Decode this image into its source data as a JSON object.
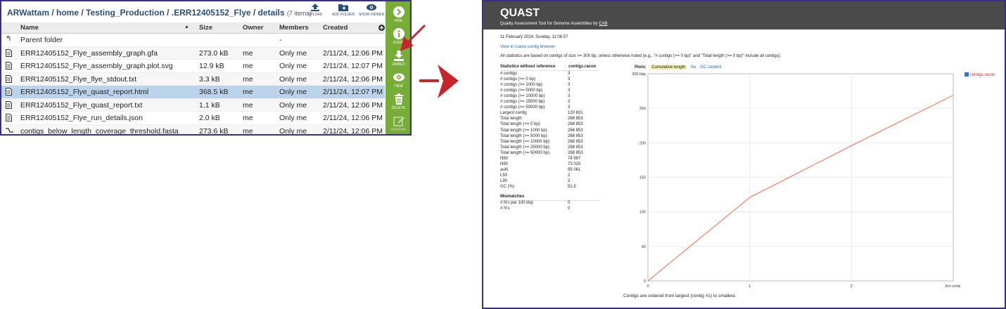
{
  "file_browser": {
    "breadcrumb": "ARWattam / home / Testing_Production / .ERR12405152_Flye / details",
    "item_count": "(7 items)",
    "toolbar": {
      "upload": "UPLOAD",
      "add_folder": "ADD FOLDER",
      "show_hidden": "SHOW HIDDEN"
    },
    "columns": {
      "name": "Name",
      "size": "Size",
      "owner": "Owner",
      "members": "Members",
      "created": "Created"
    },
    "parent": {
      "name": "Parent folder",
      "members": "-"
    },
    "rows": [
      {
        "name": "ERR12405152_Flye_assembly_graph.gfa",
        "size": "273.0 kB",
        "owner": "me",
        "members": "Only me",
        "created": "2/11/24, 12:06 PM"
      },
      {
        "name": "ERR12405152_Flye_assembly_graph.plot.svg",
        "size": "12.9 kB",
        "owner": "me",
        "members": "Only me",
        "created": "2/11/24, 12:07 PM"
      },
      {
        "name": "ERR12405152_Flye_flye_stdout.txt",
        "size": "3.3 kB",
        "owner": "me",
        "members": "Only me",
        "created": "2/11/24, 12:06 PM"
      },
      {
        "name": "ERR12405152_Flye_quast_report.html",
        "size": "368.5 kB",
        "owner": "me",
        "members": "Only me",
        "created": "2/11/24, 12:07 PM"
      },
      {
        "name": "ERR12405152_Flye_quast_report.txt",
        "size": "1.1 kB",
        "owner": "me",
        "members": "Only me",
        "created": "2/11/24, 12:06 PM"
      },
      {
        "name": "ERR12405152_Flye_run_details.json",
        "size": "2.0 kB",
        "owner": "me",
        "members": "Only me",
        "created": "2/11/24, 12:06 PM"
      },
      {
        "name": "contigs_below_length_coverage_threshold.fasta",
        "size": "273.6 kB",
        "owner": "me",
        "members": "Only me",
        "created": "2/11/24, 12:06 PM"
      }
    ],
    "sidebar": {
      "hide": "HIDE",
      "guide": "GUIDE",
      "download": "DWNLD",
      "view": "VIEW",
      "delete": "DELETE",
      "rename": "RENAME"
    }
  },
  "quast": {
    "title": "QUAST",
    "subtitle": "Quality Assessment Tool for Genome Assemblies",
    "by": "by",
    "cab": "CAB",
    "date": "11 February 2024, Sunday, 11:06:57",
    "icarus_link": "View in Icarus contig browser",
    "note": "All statistics are based on contigs of size >= 300 bp, unless otherwise noted (e.g., \"# contigs (>= 0 bp)\" and \"Total length (>= 0 bp)\" include all contigs).",
    "stats_header": "Statistics without reference",
    "assembly": "contigs.racon",
    "stats": [
      [
        "# contigs",
        "3"
      ],
      [
        "# contigs (>= 0 bp)",
        "3"
      ],
      [
        "# contigs (>= 1000 bp)",
        "3"
      ],
      [
        "# contigs (>= 5000 bp)",
        "3"
      ],
      [
        "# contigs (>= 10000 bp)",
        "3"
      ],
      [
        "# contigs (>= 25000 bp)",
        "3"
      ],
      [
        "# contigs (>= 50000 bp)",
        "3"
      ],
      [
        "Largest contig",
        "120 831"
      ],
      [
        "Total length",
        "268 853"
      ],
      [
        "Total length (>= 0 bp)",
        "268 853"
      ],
      [
        "Total length (>= 1000 bp)",
        "268 853"
      ],
      [
        "Total length (>= 5000 bp)",
        "268 853"
      ],
      [
        "Total length (>= 10000 bp)",
        "268 853"
      ],
      [
        "Total length (>= 25000 bp)",
        "268 853"
      ],
      [
        "Total length (>= 50000 bp)",
        "268 853"
      ],
      [
        "N50",
        "74 997"
      ],
      [
        "N90",
        "73 025"
      ],
      [
        "auN",
        "95 061"
      ],
      [
        "L50",
        "2"
      ],
      [
        "L90",
        "3"
      ],
      [
        "GC (%)",
        "51.5"
      ]
    ],
    "mismatches_header": "Mismatches",
    "mismatches": [
      [
        "# N's per 100 kbp",
        "0"
      ],
      [
        "# N's",
        "0"
      ]
    ],
    "plots_label": "Plots:",
    "plot_tabs": [
      "Cumulative length",
      "Nx",
      "GC content"
    ],
    "legend_label": "contigs.racon",
    "footer": "Contigs are ordered from largest (contig #1) to smallest.",
    "line_color": "#f47c67"
  },
  "chart_data": {
    "type": "line",
    "title": "",
    "xlabel": "contig",
    "ylabel": "kbp",
    "x": [
      0,
      1,
      2,
      3
    ],
    "series": [
      {
        "name": "contigs.racon",
        "values": [
          0,
          120.831,
          195.828,
          268.853
        ]
      }
    ],
    "xlim": [
      0,
      3
    ],
    "ylim": [
      0,
      300
    ],
    "yticks": [
      "0",
      "50",
      "100",
      "150",
      "200",
      "250",
      "300 kbp"
    ],
    "xticks": [
      "0",
      "1",
      "2",
      "3rd contig"
    ],
    "grid": true,
    "legend": "top-right"
  }
}
